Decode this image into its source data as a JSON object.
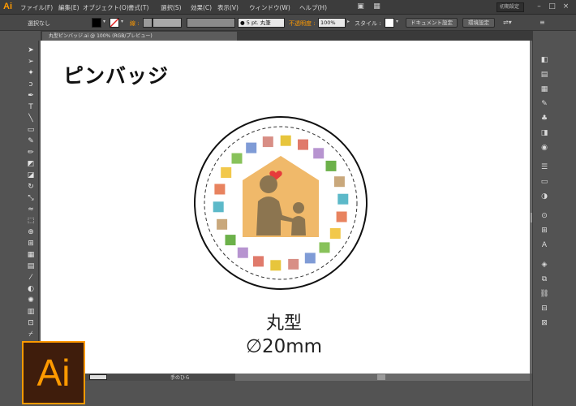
{
  "app": {
    "logo_small": "Ai",
    "logo_large": "Ai"
  },
  "menu": [
    "ファイル(F)",
    "編集(E)",
    "オブジェクト(O)",
    "書式(T)",
    "選択(S)",
    "効果(C)",
    "表示(V)",
    "ウィンドウ(W)",
    "ヘルプ(H)"
  ],
  "workspace": "初期設定",
  "controlbar": {
    "selection": "選択なし",
    "stroke_label": "線 :",
    "brush_value": "5 pt. 丸筆",
    "opacity_label": "不透明度 :",
    "opacity_value": "100%",
    "style_label": "スタイル :",
    "doc_setup_button": "ドキュメント設定",
    "prefs_button": "環境設定"
  },
  "doc_tab": "丸型ピンバッジ.ai @ 100% (RGB/プレビュー)",
  "statusbar": {
    "tool": "手のひら"
  },
  "canvas": {
    "title": "ピンバッジ",
    "shape_name": "丸型",
    "diameter": "∅20mm"
  },
  "colors": {
    "accent": "#ff9a00",
    "house": "#f0b96a",
    "figures": "#8c7550",
    "heart": "#e63b3b",
    "squares": [
      "#e7c53c",
      "#e07a6b",
      "#b794d0",
      "#6cb14a",
      "#c9a87c",
      "#5cb9c9",
      "#e8835f",
      "#f2c84b",
      "#88c25a",
      "#7f9bd6",
      "#d88e85"
    ]
  }
}
